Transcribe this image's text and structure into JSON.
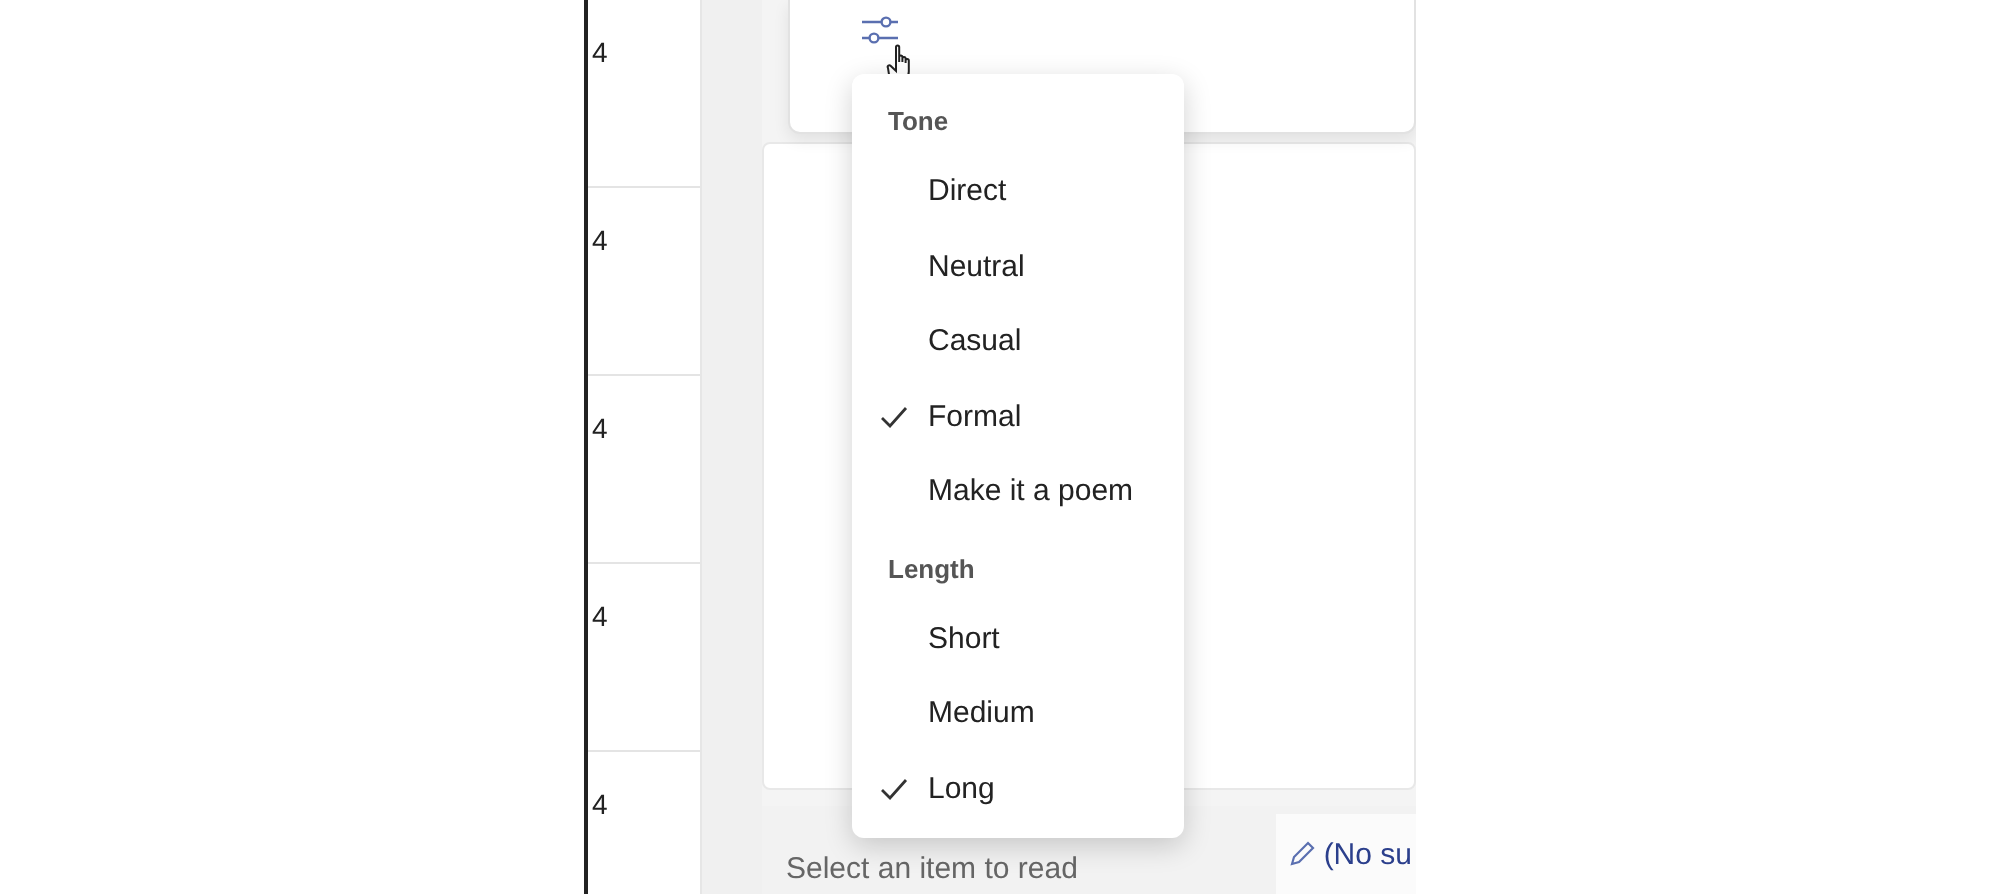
{
  "list": {
    "rows": [
      {
        "text": "4"
      },
      {
        "text": "4"
      },
      {
        "text": "4"
      },
      {
        "text": "4"
      },
      {
        "text": "4"
      }
    ]
  },
  "menu": {
    "groups": [
      {
        "header": "Tone",
        "items": [
          {
            "label": "Direct",
            "checked": false
          },
          {
            "label": "Neutral",
            "checked": false
          },
          {
            "label": "Casual",
            "checked": false
          },
          {
            "label": "Formal",
            "checked": true
          },
          {
            "label": "Make it a poem",
            "checked": false
          }
        ]
      },
      {
        "header": "Length",
        "items": [
          {
            "label": "Short",
            "checked": false
          },
          {
            "label": "Medium",
            "checked": false
          },
          {
            "label": "Long",
            "checked": true
          }
        ]
      }
    ]
  },
  "reading_pane": {
    "message": "Select an item to read"
  },
  "signature_button": {
    "label": "(No su"
  }
}
